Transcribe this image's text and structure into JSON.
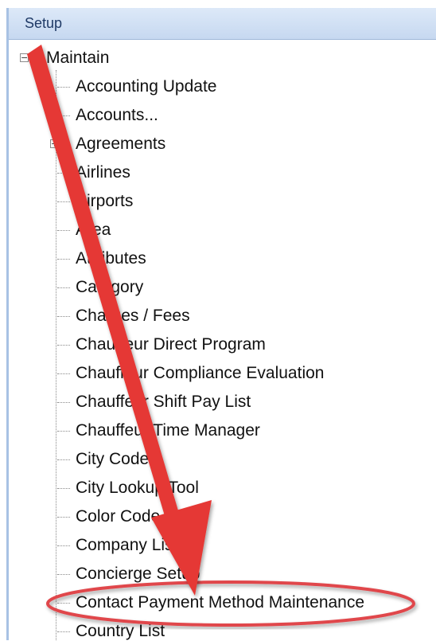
{
  "panel": {
    "title": "Setup"
  },
  "tree": {
    "root": {
      "label": "Maintain",
      "expander": "−"
    },
    "items": [
      {
        "label": "Accounting Update",
        "expander": ""
      },
      {
        "label": "Accounts...",
        "expander": "+"
      },
      {
        "label": "Agreements",
        "expander": "+"
      },
      {
        "label": "Airlines",
        "expander": ""
      },
      {
        "label": "Airports",
        "expander": ""
      },
      {
        "label": "Area",
        "expander": ""
      },
      {
        "label": "Attributes",
        "expander": ""
      },
      {
        "label": "Category",
        "expander": ""
      },
      {
        "label": "Charges / Fees",
        "expander": ""
      },
      {
        "label": "Chauffeur Direct Program",
        "expander": ""
      },
      {
        "label": "Chauffeur Compliance Evaluation",
        "expander": ""
      },
      {
        "label": "Chauffeur Shift Pay List",
        "expander": ""
      },
      {
        "label": "Chauffeur Time Manager",
        "expander": ""
      },
      {
        "label": "City Codes",
        "expander": ""
      },
      {
        "label": "City Lookup Tool",
        "expander": ""
      },
      {
        "label": "Color Code List",
        "expander": ""
      },
      {
        "label": "Company List",
        "expander": ""
      },
      {
        "label": "Concierge Setup",
        "expander": ""
      },
      {
        "label": "Contact Payment Method Maintenance",
        "expander": ""
      },
      {
        "label": "Country List",
        "expander": ""
      }
    ]
  },
  "annotation": {
    "arrow_color": "#e53935",
    "highlight_color": "#e0474c",
    "highlighted_item": "Contact Payment Method Maintenance"
  }
}
